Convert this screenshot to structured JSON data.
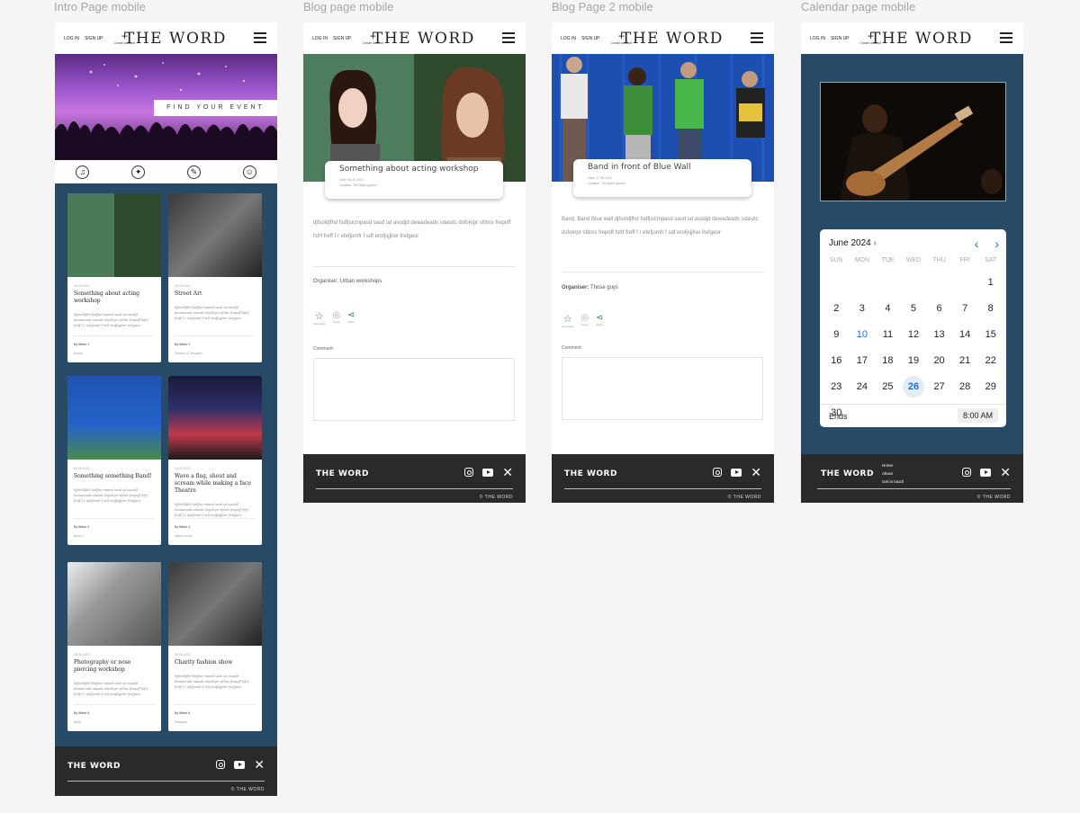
{
  "frames": {
    "intro": "Intro Page mobile",
    "blog": "Blog page mobile",
    "blog2": "Blog Page 2 mobile",
    "calendar": "Calendar page mobile"
  },
  "header": {
    "login": "LOG IN",
    "signup": "SIGN UP",
    "plus": "+",
    "create": "Create account",
    "logo": "THE WORD"
  },
  "intro": {
    "hero_button": "FIND YOUR EVENT",
    "category_icons": [
      "music-icon",
      "dance-icon",
      "art-icon",
      "theatre-icon"
    ],
    "cards": [
      {
        "date": "06.06.2021",
        "title": "Something about acting workshop",
        "desc": "djfsoldjfhd fsdfjsicmpasd sasd sd asodjd dewadeads sdasdc dsfokrpr sfdms frepoff fsfrf freff f r efefjomfr f sdf erofjsjjfrer frefgeor",
        "writer": "By Writer 1",
        "tag": "Actors",
        "img": "actors"
      },
      {
        "date": "06.06.2021",
        "title": "Street Art",
        "desc": "djfsoldjfhd fsdfjsicmpasd sasd sd asodjd dewadeads sdasdc dsfokrpr sfdms frepoff fsfrf freff f r efefjomfr f sdf erofjsjjfrer frefgeor",
        "writer": "By Writer 2",
        "tag": "Fashion & Designer",
        "img": "street"
      },
      {
        "date": "06.06.2021",
        "title": "Something something Band!",
        "desc": "djfsoldjfhd fsdfjsicmpasd sasd sd asodjd dewadeads sdasdc dsfokrpr sfdms frepoff fsfrf freff f r efefjomfr f sdf erofjsjjfrer frefgeor",
        "writer": "By Writer 3",
        "tag": "Band 1",
        "img": "band"
      },
      {
        "date": "06.06.2021",
        "title": "Wave a flag, shout and scream while making a face Theatre",
        "desc": "djfsoldjfhd fsdfjsicmpasd sasd sd asodjd dewadeads sdasdc dsfokrpr sfdms frepoff fsfrf freff f r efefjomfr f sdf erofjsjjfrer frefgeor",
        "writer": "By Writer 4",
        "tag": "Wave on sky",
        "img": "theatre"
      },
      {
        "date": "06.06.2021",
        "title": "Photography or nose piercing workshop",
        "desc": "djfsoldjfhd fsdfjsicmpasd sasd sd asodjd dewadeads sdasdc dsfokrpr sfdms frepoff fsfrf freff f r efefjomfr f sdf erofjsjjfrer frefgeor",
        "writer": "By Writer 5",
        "tag": "Artist",
        "img": "photo"
      },
      {
        "date": "06.06.2021",
        "title": "Charity fashion show",
        "desc": "djfsoldjfhd fsdfjsicmpasd sasd sd asodjd dewadeads sdasdc dsfokrpr sfdms frepoff fsfrf freff f r efefjomfr f sdf erofjsjjfrer frefgeor",
        "writer": "By Writer 6",
        "tag": "Designer",
        "img": "street"
      }
    ]
  },
  "blog": {
    "title": "Something about acting workshop",
    "meta1": "Date: 06.06.2021",
    "meta2": "Location: The Bank garden",
    "body": "djfsoldjfhd fsdfjsicmpasd  sasd sd asodjd dewadeads sdasdc dsfokrpr sfdms frepoff  fsfrf freff f r efefjomfr f sdf erofjsjjfrer frefgeor",
    "organiser": "Organiser: Urban workshops",
    "actions": [
      "Interested",
      "Going",
      "Share"
    ],
    "comment": "Comment:"
  },
  "blog2": {
    "title": "Band in front of Blue Wall",
    "meta1": "Date: 17.06.2021",
    "meta2": "Location: The Bank garden",
    "body": "Band, Band Blue wall djfsoldjfhd fsdfjsicmpasd  sasd sd asodjd dewadeads sdasdc dsfokrpr sfdms frepoff  fsfrf freff f r efefjomfr f sdf erofjsjjfrer frefgeor",
    "organiser_label": "Organiser:",
    "organiser": "Those guys",
    "actions": [
      "Interested",
      "Going",
      "Share"
    ],
    "comment": "Comment:"
  },
  "calendar": {
    "month": "June 2024",
    "chev": "›",
    "prev": "‹",
    "next": "›",
    "dow": [
      "SUN",
      "MON",
      "TUE",
      "WED",
      "THU",
      "FRI",
      "SAT"
    ],
    "days": [
      "",
      "",
      "",
      "",
      "",
      "",
      "1",
      "2",
      "3",
      "4",
      "5",
      "6",
      "7",
      "8",
      "9",
      "10",
      "11",
      "12",
      "13",
      "14",
      "15",
      "16",
      "17",
      "18",
      "19",
      "20",
      "21",
      "22",
      "23",
      "24",
      "25",
      "26",
      "27",
      "28",
      "29",
      "30"
    ],
    "today": "10",
    "selected": "26",
    "ends_label": "Ends",
    "ends_time": "8:00 AM"
  },
  "footer": {
    "title": "THE WORD",
    "copy": "© THE WORD",
    "links": [
      "Home",
      "About",
      "Get in touch"
    ]
  },
  "colors": {
    "navy": "#274a67",
    "footer": "#2a2a2a",
    "accent_green": "#2b8a3e",
    "calendar_blue": "#1a6fd6"
  }
}
